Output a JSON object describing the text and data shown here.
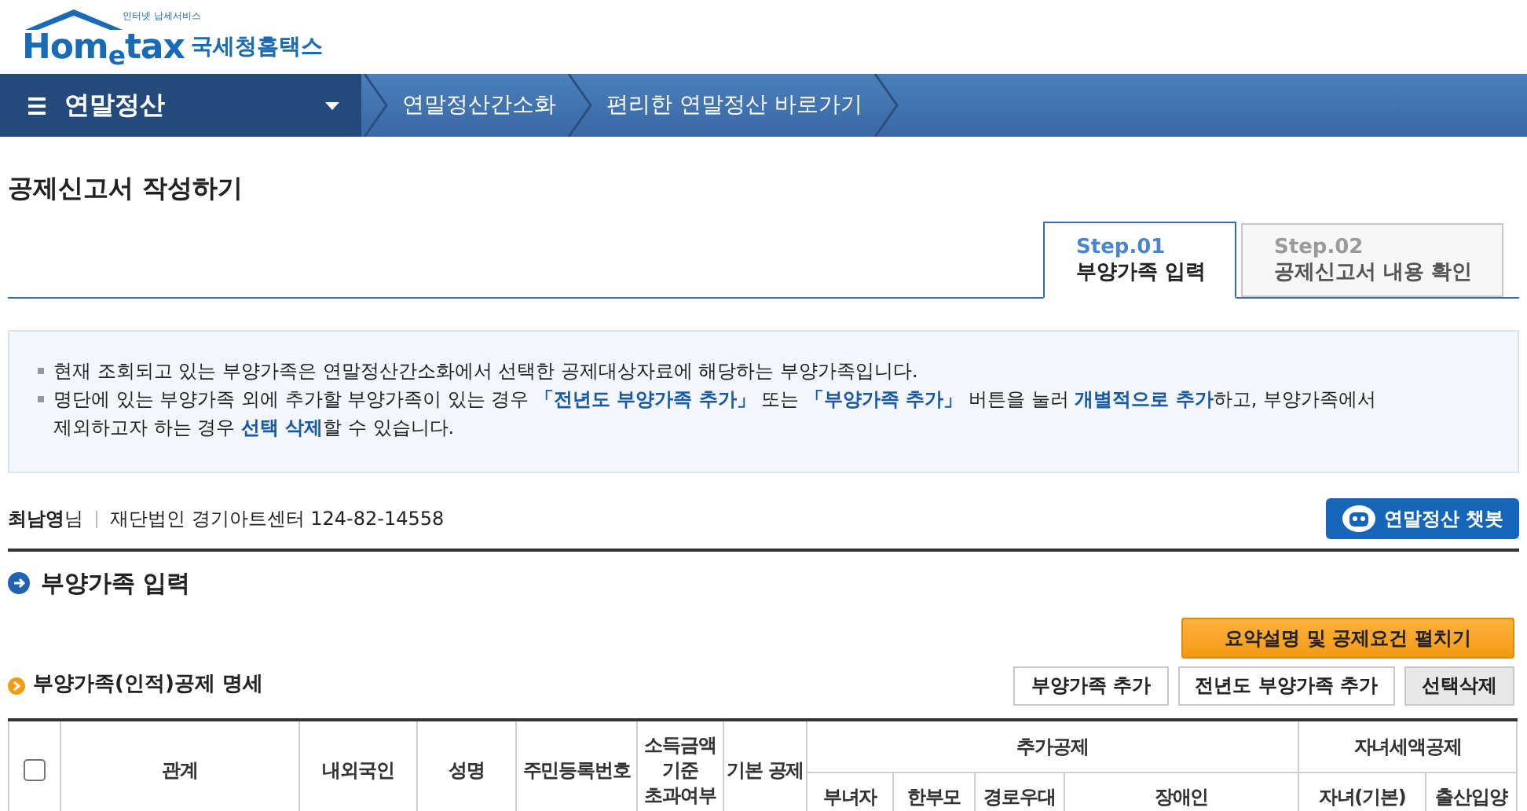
{
  "logo": {
    "tagline": "인터넷 납세서비스",
    "wordmark": "Hom$_{e}$tax",
    "name": "국세청홈택스"
  },
  "nav": {
    "menu": "연말정산",
    "links": [
      "연말정산간소화",
      "편리한 연말정산 바로가기"
    ]
  },
  "page_title": "공제신고서 작성하기",
  "steps": [
    {
      "step": "Step.01",
      "label": "부양가족 입력",
      "selected": true
    },
    {
      "step": "Step.02",
      "label": "공제신고서 내용 확인",
      "selected": false
    }
  ],
  "notice": [
    "현재 조회되고 있는 부양가족은 연말정산간소화에서 선택한 공제대상자료에 해당하는 부양가족입니다.",
    "명단에 있는 부양가족 외에 추가할 부양가족이 있는 경우 **「전년도 부양가족 추가」** 또는 **「부양가족 추가」** 버튼을 눌러 **개별적으로 추가**하고, 부양가족에서 제외하고자 하는 경우 **선택 삭제**할 수 있습니다."
  ],
  "user": {
    "name": "최남영",
    "suffix": "님",
    "company": "재단법인 경기아트센터 124-82-14558"
  },
  "chatbot_button": "연말정산 챗봇",
  "section_title": "부양가족 입력",
  "summary_button": "요약설명 및 공제요건 펼치기",
  "subsection_title": "부양가족(인적)공제 명세",
  "actions": [
    "부양가족 추가",
    "전년도 부양가족 추가",
    "선택삭제"
  ],
  "table": {
    "select_all": {
      "checked": false
    },
    "columns": [
      {
        "label": "관계"
      },
      {
        "label": "내외국인"
      },
      {
        "label": "성명"
      },
      {
        "label": "주민등록번호"
      },
      {
        "label": "소득금액 기준 초과여부"
      },
      {
        "label": "기본 공제"
      },
      {
        "label": "추가공제",
        "children": [
          {
            "label": "부녀자"
          },
          {
            "label": "한부모"
          },
          {
            "label": "경로우대"
          },
          {
            "label": "장애인"
          }
        ]
      },
      {
        "label": "자녀세액공제",
        "children": [
          {
            "label": "자녀(기본)"
          },
          {
            "label": "출산입양"
          }
        ]
      }
    ]
  }
}
